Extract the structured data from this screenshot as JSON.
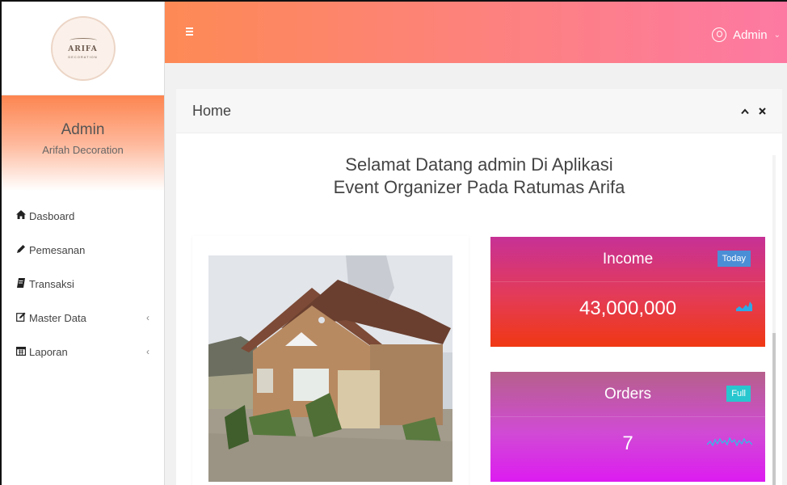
{
  "brand": {
    "logo_title": "ARIFA",
    "logo_subtitle": "DECORATION"
  },
  "sidebar": {
    "profile_name": "Admin",
    "profile_subtitle": "Arifah Decoration",
    "items": [
      {
        "label": "Dasboard",
        "icon": "home-icon",
        "has_submenu": false
      },
      {
        "label": "Pemesanan",
        "icon": "pencil-icon",
        "has_submenu": false
      },
      {
        "label": "Transaksi",
        "icon": "book-icon",
        "has_submenu": false
      },
      {
        "label": "Master Data",
        "icon": "edit-icon",
        "has_submenu": true
      },
      {
        "label": "Laporan",
        "icon": "calendar-icon",
        "has_submenu": true
      }
    ]
  },
  "topbar": {
    "menu_icon": "menu-icon",
    "user_label": "Admin",
    "user_icon": "user-circle-icon"
  },
  "panel": {
    "title": "Home",
    "collapse_icon": "chevron-up-icon",
    "close_icon": "close-icon",
    "welcome_line1": "Selamat Datang admin Di Aplikasi",
    "welcome_line2": "Event Organizer Pada Ratumas Arifa"
  },
  "stats": {
    "income": {
      "title": "Income",
      "badge": "Today",
      "value": "43,000,000",
      "icon": "area-chart-icon"
    },
    "orders": {
      "title": "Orders",
      "badge": "Full",
      "value": "7",
      "icon": "sparkline-icon"
    }
  },
  "colors": {
    "topbar_start": "#fd8a55",
    "topbar_end": "#fd79a3",
    "income_top": "#c73196",
    "income_bottom": "#f03813",
    "orders_top": "#b6608c",
    "orders_bottom": "#dd1bf1",
    "badge_today": "#4a8ed6",
    "badge_full": "#28c7cf"
  }
}
